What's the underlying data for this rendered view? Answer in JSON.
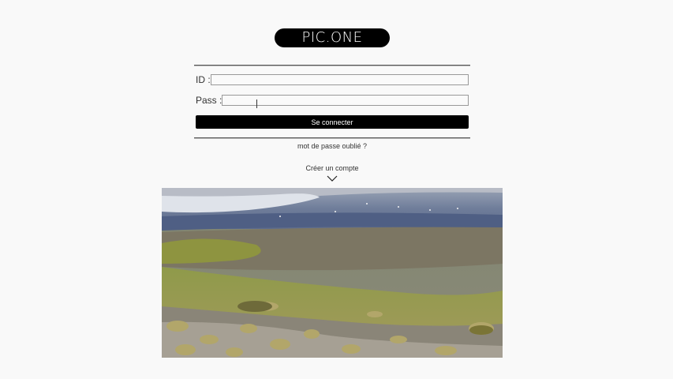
{
  "brand": {
    "logo_text": "PIC.ONE"
  },
  "login": {
    "id_label": "ID :",
    "id_value": "",
    "pass_label": "Pass :",
    "pass_value": "",
    "submit_label": "Se connecter",
    "forgot_label": "mot de passe oublié ?"
  },
  "signup": {
    "label": "Créer un compte",
    "icon": "chevron-down-icon"
  },
  "colors": {
    "background": "#f9f9f9",
    "button": "#000000",
    "button_text": "#ffffff"
  }
}
